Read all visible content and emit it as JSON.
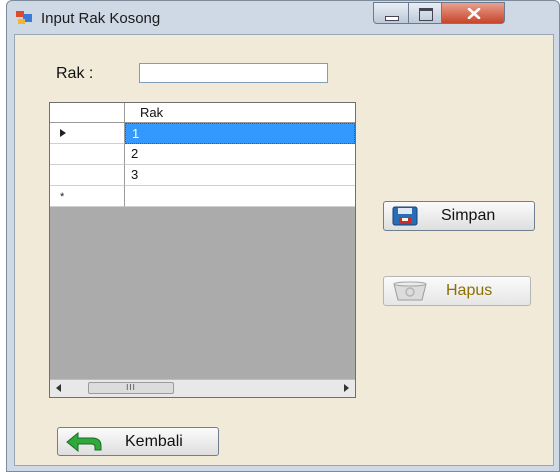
{
  "window": {
    "title": "Input Rak Kosong",
    "icon": "form-icon",
    "controls": [
      "minimize-icon",
      "maximize-icon",
      "close-icon"
    ]
  },
  "form": {
    "rak_label": "Rak  :",
    "rak_value": "",
    "rak_placeholder": ""
  },
  "grid": {
    "columns": [
      "Rak"
    ],
    "rows": [
      "1",
      "2",
      "3"
    ],
    "selected_row": 0,
    "current_row_indicator": "arrow",
    "new_row_indicator": "*",
    "scroll_thumb_text": "III"
  },
  "buttons": {
    "simpan": "Simpan",
    "hapus": "Hapus",
    "kembali": "Kembali"
  },
  "colors": {
    "selection": "#3399ff",
    "hapus_text": "#8d7000",
    "client_bg": "#f1ead9"
  }
}
